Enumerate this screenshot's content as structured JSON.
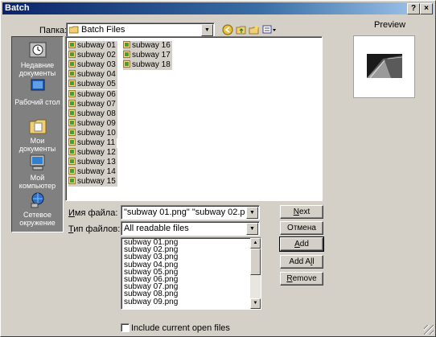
{
  "window": {
    "title": "Batch",
    "help_button": "?",
    "close_button": "×"
  },
  "toolbar": {
    "look_in_label": "Папка:",
    "look_in_value": "Batch Files"
  },
  "places": [
    {
      "label": "Недавние документы"
    },
    {
      "label": "Рабочий стол"
    },
    {
      "label": "Мои документы"
    },
    {
      "label": "Мой компьютер"
    },
    {
      "label": "Сетевое окружение"
    }
  ],
  "files": {
    "col1": [
      "subway 01",
      "subway 02",
      "subway 03",
      "subway 04",
      "subway 05",
      "subway 06",
      "subway 07",
      "subway 08",
      "subway 09",
      "subway 10",
      "subway 11",
      "subway 12",
      "subway 13",
      "subway 14",
      "subway 15"
    ],
    "col2": [
      "subway 16",
      "subway 17",
      "subway 18"
    ]
  },
  "filename": {
    "label": "Имя файла:",
    "value": "\"subway 01.png\" \"subway 02.png\" \"subway 0"
  },
  "filetype": {
    "label": "Тип файлов:",
    "value": "All readable files"
  },
  "selected": [
    "subway 01.png",
    "subway 02.png",
    "subway 03.png",
    "subway 04.png",
    "subway 05.png",
    "subway 06.png",
    "subway 07.png",
    "subway 08.png",
    "subway 09.png"
  ],
  "buttons": {
    "next": "Next",
    "cancel": "Отмена",
    "add": "Add",
    "add_all": "Add All",
    "remove": "Remove"
  },
  "preview": {
    "label": "Preview"
  },
  "options": {
    "include_open_files": "Include current open files"
  },
  "colors": {
    "title_start": "#0a246a",
    "title_end": "#a6caf0",
    "face": "#d4d0c8"
  }
}
